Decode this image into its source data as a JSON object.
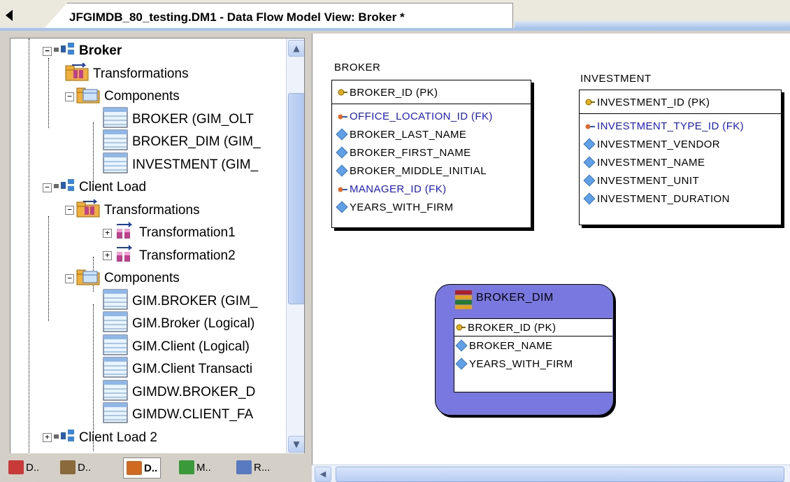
{
  "window": {
    "tab_title": "JFGIMDB_80_testing.DM1 - Data Flow Model View: Broker *"
  },
  "tree": {
    "items": [
      {
        "label": "Broker",
        "level": 0,
        "bold": true,
        "icon": "data-flow-icon"
      },
      {
        "label": "Transformations",
        "level": 1,
        "icon": "transformations-folder-icon"
      },
      {
        "label": "Components",
        "level": 1,
        "icon": "components-folder-icon"
      },
      {
        "label": "BROKER (GIM_OLT",
        "level": 2,
        "icon": "table-icon"
      },
      {
        "label": "BROKER_DIM (GIM_",
        "level": 2,
        "icon": "table-icon"
      },
      {
        "label": "INVESTMENT (GIM_",
        "level": 2,
        "icon": "table-icon"
      },
      {
        "label": "Client Load",
        "level": 0,
        "icon": "data-flow-icon"
      },
      {
        "label": "Transformations",
        "level": 1,
        "icon": "transformations-folder-icon"
      },
      {
        "label": "Transformation1",
        "level": 2,
        "icon": "transformation-icon"
      },
      {
        "label": "Transformation2",
        "level": 2,
        "icon": "transformation-icon"
      },
      {
        "label": "Components",
        "level": 1,
        "icon": "components-folder-icon"
      },
      {
        "label": "GIM.BROKER (GIM_",
        "level": 2,
        "icon": "table-icon"
      },
      {
        "label": "GIM.Broker (Logical)",
        "level": 2,
        "icon": "table-icon"
      },
      {
        "label": "GIM.Client (Logical)",
        "level": 2,
        "icon": "table-icon"
      },
      {
        "label": "GIM.Client Transacti",
        "level": 2,
        "icon": "table-icon"
      },
      {
        "label": "GIMDW.BROKER_D",
        "level": 2,
        "icon": "table-icon"
      },
      {
        "label": "GIMDW.CLIENT_FA",
        "level": 2,
        "icon": "table-icon"
      },
      {
        "label": "Client Load 2",
        "level": 0,
        "icon": "data-flow-icon"
      }
    ]
  },
  "bottom_tabs": [
    {
      "label": "D..",
      "icon": "data-model-icon",
      "active": false
    },
    {
      "label": "D..",
      "icon": "dictionary-icon",
      "active": false
    },
    {
      "label": "D..",
      "icon": "data-lineage-icon",
      "active": true
    },
    {
      "label": "M..",
      "icon": "macro-icon",
      "active": false
    },
    {
      "label": "R...",
      "icon": "repository-icon",
      "active": false
    }
  ],
  "entities": {
    "broker": {
      "title": "BROKER",
      "pk": "BROKER_ID (PK)",
      "rows": [
        {
          "text": "OFFICE_LOCATION_ID (FK)",
          "fk": true
        },
        {
          "text": "BROKER_LAST_NAME",
          "fk": false
        },
        {
          "text": "BROKER_FIRST_NAME",
          "fk": false
        },
        {
          "text": "BROKER_MIDDLE_INITIAL",
          "fk": false
        },
        {
          "text": "MANAGER_ID (FK)",
          "fk": true
        },
        {
          "text": "YEARS_WITH_FIRM",
          "fk": false
        }
      ]
    },
    "investment": {
      "title": "INVESTMENT",
      "pk": "INVESTMENT_ID (PK)",
      "rows": [
        {
          "text": "INVESTMENT_TYPE_ID (FK)",
          "fk": true
        },
        {
          "text": "INVESTMENT_VENDOR",
          "fk": false
        },
        {
          "text": "INVESTMENT_NAME",
          "fk": false
        },
        {
          "text": "INVESTMENT_UNIT",
          "fk": false
        },
        {
          "text": "INVESTMENT_DURATION",
          "fk": false
        }
      ]
    },
    "broker_dim": {
      "title": "BROKER_DIM",
      "pk": "BROKER_ID (PK)",
      "rows": [
        {
          "text": "BROKER_NAME",
          "fk": false
        },
        {
          "text": "YEARS_WITH_FIRM",
          "fk": false
        }
      ]
    }
  },
  "colors": {
    "fk_text": "#1a1ae6",
    "dim_fill": "#7878e0",
    "tab_strip": "#a9c4ea"
  }
}
